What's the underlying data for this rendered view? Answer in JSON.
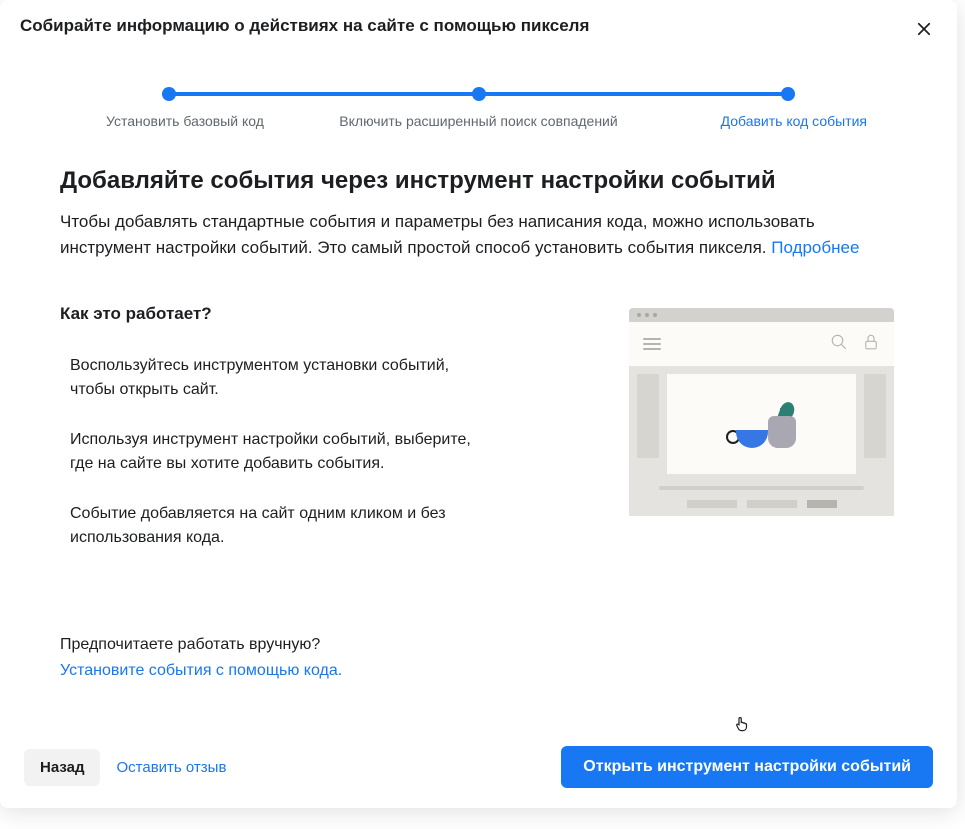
{
  "header": {
    "title": "Собирайте информацию о действиях на сайте с помощью пикселя"
  },
  "stepper": {
    "steps": [
      {
        "label": "Установить базовый код"
      },
      {
        "label": "Включить расширенный поиск совпадений"
      },
      {
        "label": "Добавить код события"
      }
    ]
  },
  "main": {
    "heading": "Добавляйте события через инструмент настройки событий",
    "description": "Чтобы добавлять стандартные события и параметры без написания кода, можно использовать инструмент настройки событий. Это самый простой способ установить события пикселя. ",
    "learn_more": "Подробнее"
  },
  "how": {
    "heading": "Как это работает?",
    "steps": [
      "Воспользуйтесь инструментом установки событий, чтобы открыть сайт.",
      "Используя инструмент настройки событий, выберите, где на сайте вы хотите добавить события.",
      "Событие добавляется на сайт одним кликом и без использования кода."
    ]
  },
  "manual": {
    "question": "Предпочитаете работать вручную?",
    "link": "Установите события с помощью кода."
  },
  "footer": {
    "back": "Назад",
    "feedback": "Оставить отзыв",
    "primary": "Открыть инструмент настройки событий"
  }
}
